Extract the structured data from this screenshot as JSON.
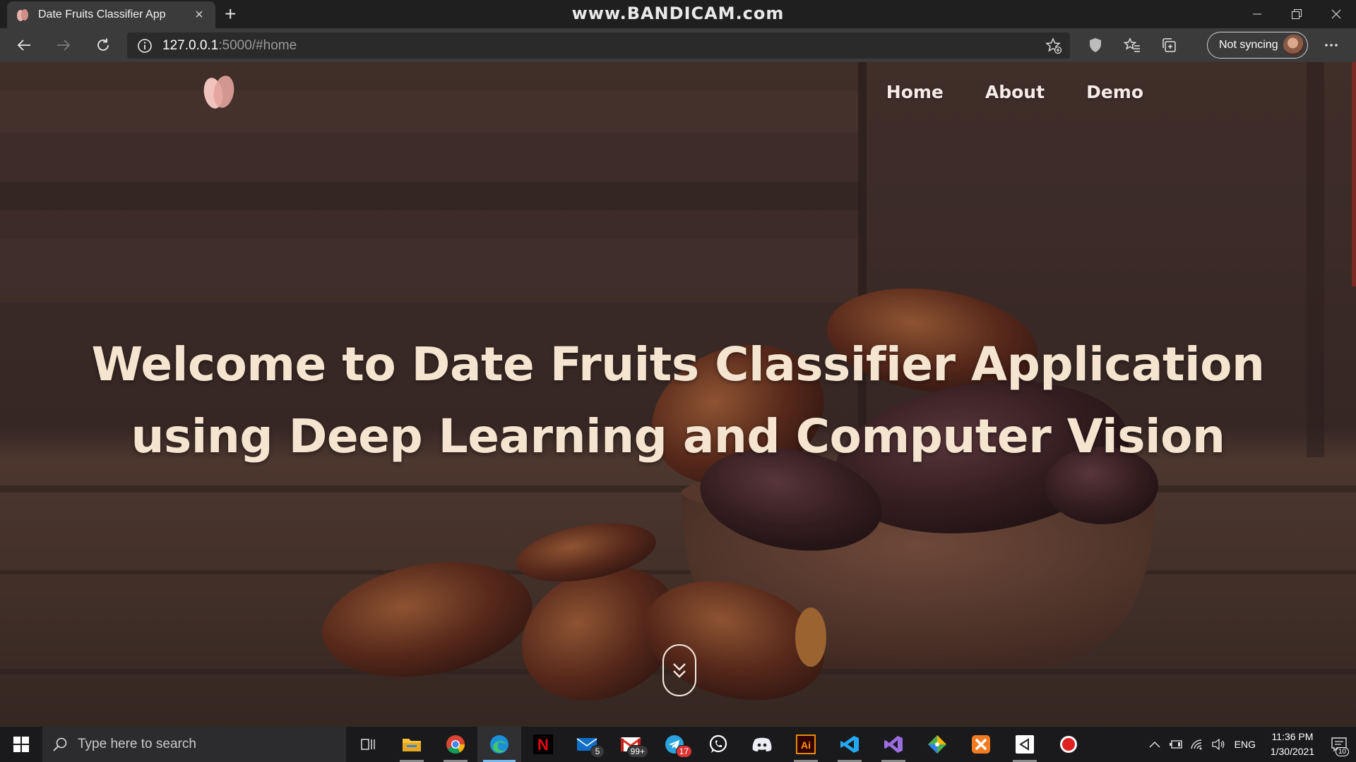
{
  "browser": {
    "tab": {
      "title": "Date Fruits Classifier App",
      "close": "×"
    },
    "new_tab": "+",
    "watermark": "www.BANDICAM.com",
    "url_host": "127.0.0.1",
    "url_path": ":5000/#home",
    "sync_label": "Not syncing",
    "more": "···"
  },
  "site": {
    "nav": [
      "Home",
      "About",
      "Demo"
    ],
    "hero_line1": "Welcome to Date Fruits Classifier Application",
    "hero_line2": "using Deep Learning and Computer Vision"
  },
  "taskbar": {
    "search_placeholder": "Type here to search",
    "apps": [
      {
        "name": "task-view-icon",
        "badge": ""
      },
      {
        "name": "file-explorer-icon",
        "badge": ""
      },
      {
        "name": "chrome-icon",
        "badge": ""
      },
      {
        "name": "edge-icon",
        "badge": ""
      },
      {
        "name": "netflix-icon",
        "badge": ""
      },
      {
        "name": "mail-icon",
        "badge": "5"
      },
      {
        "name": "gmail-icon",
        "badge": "99+"
      },
      {
        "name": "telegram-icon",
        "badge": "17"
      },
      {
        "name": "whatsapp-icon",
        "badge": ""
      },
      {
        "name": "discord-icon",
        "badge": ""
      },
      {
        "name": "illustrator-icon",
        "badge": ""
      },
      {
        "name": "vscode-icon",
        "badge": ""
      },
      {
        "name": "visual-studio-icon",
        "badge": ""
      },
      {
        "name": "git-icon",
        "badge": ""
      },
      {
        "name": "xampp-icon",
        "badge": ""
      },
      {
        "name": "unity-icon",
        "badge": ""
      },
      {
        "name": "bandicam-record-icon",
        "badge": ""
      }
    ],
    "illustrator_text": "Ai",
    "netflix_text": "N",
    "lang": "ENG",
    "time": "11:36 PM",
    "date": "1/30/2021",
    "notifications": "10"
  },
  "colors": {
    "accent": "#76b9ed",
    "hero_text": "#f5e4cf",
    "nav_text": "#f6ece4",
    "browser_bg": "#3b3b3b"
  }
}
